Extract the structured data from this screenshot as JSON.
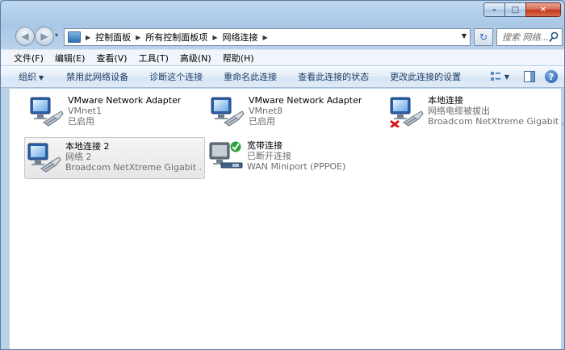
{
  "window": {
    "controls": {
      "minimize": "–",
      "maximize": "□",
      "close": "✕"
    }
  },
  "nav": {
    "back_icon": "back-arrow-icon",
    "forward_icon": "forward-arrow-icon",
    "history_icon": "▾",
    "breadcrumbs": [
      "控制面板",
      "所有控制面板项",
      "网络连接"
    ],
    "search_placeholder": "搜索 网络...",
    "refresh_icon": "refresh-icon"
  },
  "menubar": [
    "文件(F)",
    "编辑(E)",
    "查看(V)",
    "工具(T)",
    "高级(N)",
    "帮助(H)"
  ],
  "commands": {
    "organize": "组织",
    "disable": "禁用此网络设备",
    "diagnose": "诊断这个连接",
    "rename": "重命名此连接",
    "view_status": "查看此连接的状态",
    "change_settings": "更改此连接的设置"
  },
  "connections": [
    {
      "name": "VMware Network Adapter",
      "status": "VMnet1",
      "device": "已启用",
      "icon": "network-adapter-icon",
      "overlay": ""
    },
    {
      "name": "VMware Network Adapter",
      "status": "VMnet8",
      "device": "已启用",
      "icon": "network-adapter-icon",
      "overlay": ""
    },
    {
      "name": "本地连接",
      "status": "网络电缆被拔出",
      "device": "Broadcom NetXtreme Gigabit ...",
      "icon": "network-adapter-icon",
      "overlay": "red-x"
    },
    {
      "name": "本地连接 2",
      "status": "网络  2",
      "device": "Broadcom NetXtreme Gigabit ...",
      "icon": "network-adapter-icon",
      "overlay": "",
      "selected": true
    },
    {
      "name": "宽带连接",
      "status": "已断开连接",
      "device": "WAN Miniport (PPPOE)",
      "icon": "broadband-icon",
      "overlay": "green-check"
    }
  ],
  "colors": {
    "accent": "#1e3f66",
    "selected_bg": "#e9e9e9",
    "status_text": "#6d6d6d",
    "error": "#d21818",
    "ok": "#2aa43a"
  }
}
